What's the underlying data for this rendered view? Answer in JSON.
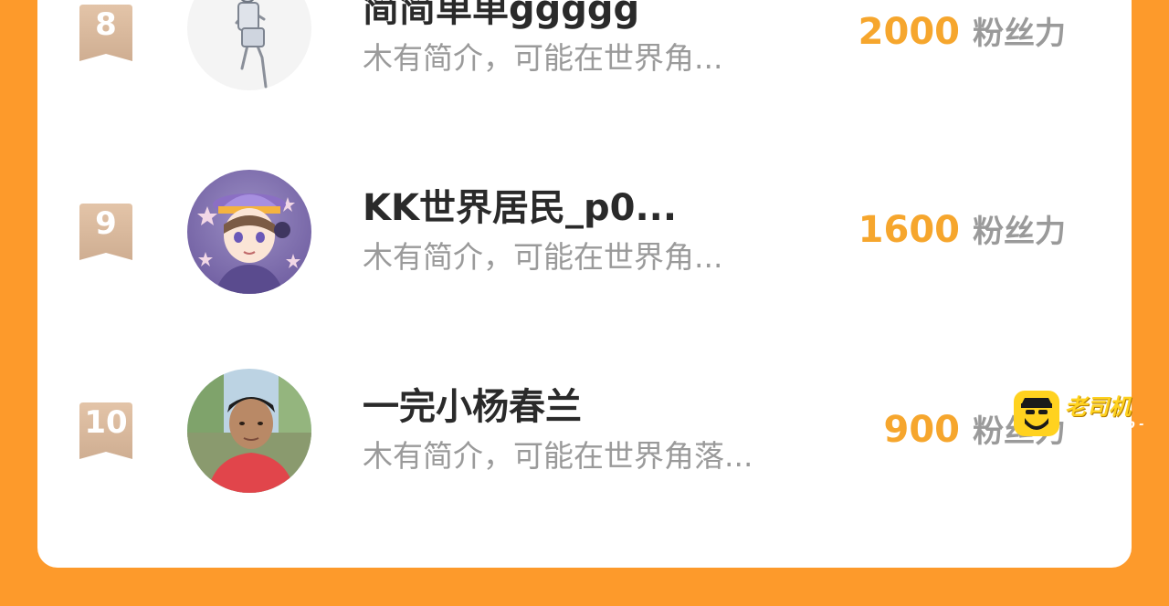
{
  "ranking": {
    "rows": [
      {
        "rank": "8",
        "name": "简简单单ggggg",
        "bio": "木有简介，可能在世界角...",
        "score": "2000",
        "unit": "粉丝力"
      },
      {
        "rank": "9",
        "name": "KK世界居民_p0...",
        "bio": "木有简介，可能在世界角...",
        "score": "1600",
        "unit": "粉丝力"
      },
      {
        "rank": "10",
        "name": "一完小杨春兰",
        "bio": "木有简介，可能在世界角落...",
        "score": "900",
        "unit": "粉丝力"
      }
    ]
  },
  "watermark": {
    "title": "老司机",
    "url": "- lsjmh.top -"
  },
  "colors": {
    "background": "#FD9A2B",
    "score": "#F6A62D",
    "rank_badge": "#D9B79B",
    "card": "#FFFFFF"
  }
}
